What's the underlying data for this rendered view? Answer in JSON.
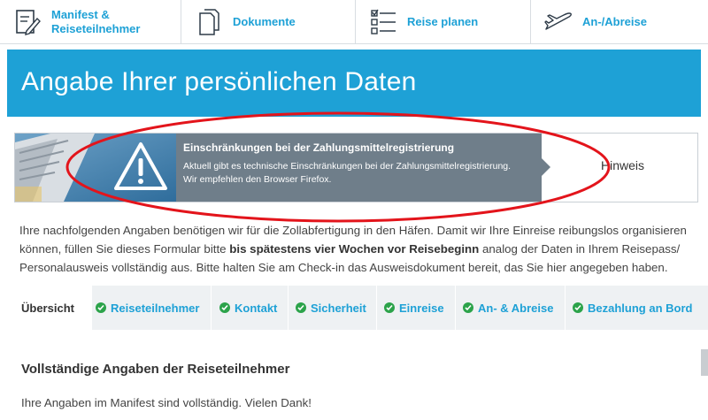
{
  "nav": {
    "items": [
      {
        "label": "Manifest & Reiseteilnehmer",
        "icon": "manifest-edit-icon"
      },
      {
        "label": "Dokumente",
        "icon": "documents-icon"
      },
      {
        "label": "Reise planen",
        "icon": "checklist-icon"
      },
      {
        "label": "An-/Abreise",
        "icon": "airplane-icon"
      }
    ]
  },
  "header": {
    "title": "Angabe Ihrer persönlichen Daten"
  },
  "notice": {
    "title": "Einschränkungen bei der Zahlungsmittelregistrierung",
    "line1": "Aktuell gibt es technische Einschränkungen bei der Zahlungsmittelregistrierung.",
    "line2": "Wir empfehlen den Browser Firefox.",
    "hint": "Hinweis",
    "icon": "warning-icon"
  },
  "intro": {
    "part1": "Ihre nachfolgenden Angaben benötigen wir für die Zollabfertigung in den Häfen. Damit wir Ihre Einreise reibungslos organisieren können, füllen Sie dieses Formular bitte ",
    "bold": "bis spätestens vier Wochen vor Reisebeginn",
    "part2": " analog der Daten in Ihrem Reisepass/ Personalausweis vollständig aus. Bitte halten Sie am Check-in das Ausweisdokument bereit, das Sie hier angegeben haben."
  },
  "tabs": {
    "active": "Übersicht",
    "items": [
      "Reiseteilnehmer",
      "Kontakt",
      "Sicherheit",
      "Einreise",
      "An- & Abreise",
      "Bezahlung an Bord"
    ]
  },
  "summary": {
    "heading": "Vollständige Angaben der Reiseteilnehmer",
    "text": "Ihre Angaben im Manifest sind vollständig. Vielen Dank!"
  },
  "colors": {
    "accent": "#1ea1d6",
    "notice_bg": "#6f7e8a",
    "check": "#2ca34a",
    "annotation": "#e3141b"
  }
}
